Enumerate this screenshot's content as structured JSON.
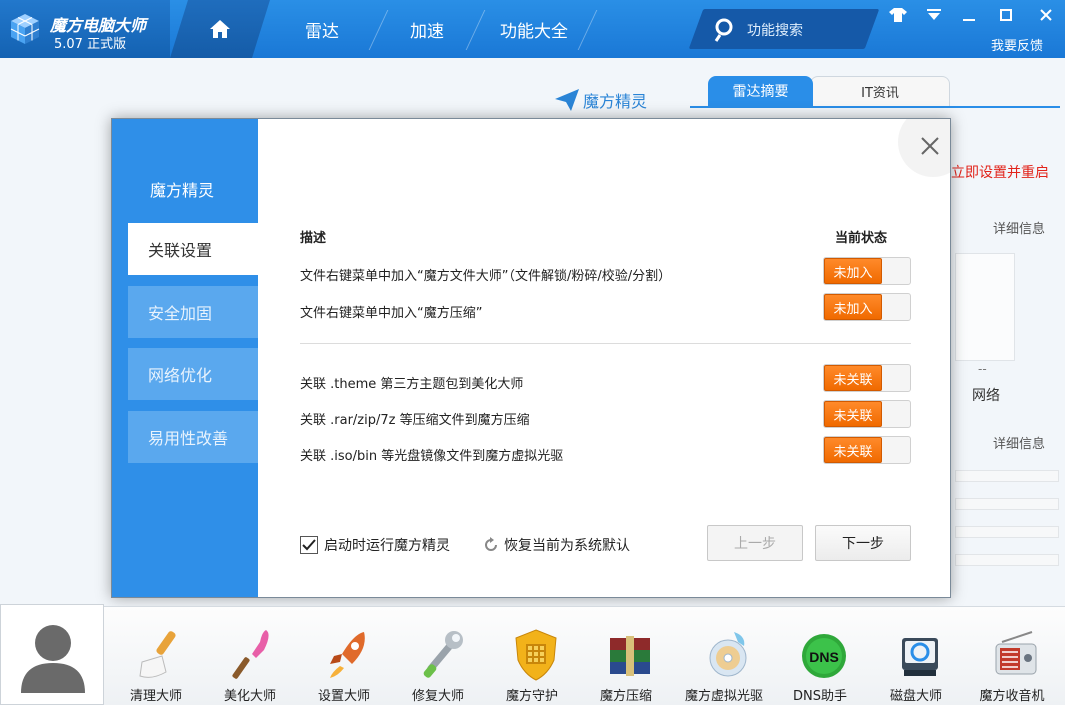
{
  "app": {
    "title": "魔方电脑大师",
    "version": "5.07 正式版"
  },
  "nav": {
    "items": [
      "雷达",
      "加速",
      "功能大全"
    ],
    "search_label": "功能搜索",
    "feedback": "我要反馈"
  },
  "background": {
    "wizard_link": "魔方精灵",
    "tabs": [
      "雷达摘要",
      "IT资讯"
    ],
    "red_text": "立即设置并重启",
    "detail_1": "详细信息",
    "detail_2": "详细信息",
    "dash": "--",
    "net_label": "网络"
  },
  "dialog": {
    "side_title": "魔方精灵",
    "side_items": [
      "关联设置",
      "安全加固",
      "网络优化",
      "易用性改善"
    ],
    "active_index": 0,
    "col_desc": "描述",
    "col_status": "当前状态",
    "rows": [
      {
        "text": "文件右键菜单中加入“魔方文件大师”（文件解锁/粉碎/校验/分割）",
        "status": "未加入"
      },
      {
        "text": "文件右键菜单中加入“魔方压缩”",
        "status": "未加入"
      },
      {
        "text": "关联 .theme 第三方主题包到美化大师",
        "status": "未关联"
      },
      {
        "text": "关联 .rar/zip/7z 等压缩文件到魔方压缩",
        "status": "未关联"
      },
      {
        "text": "关联 .iso/bin 等光盘镜像文件到魔方虚拟光驱",
        "status": "未关联"
      }
    ],
    "startup_label": "启动时运行魔方精灵",
    "startup_checked": true,
    "restore_label": "恢复当前为系统默认",
    "prev_label": "上一步",
    "next_label": "下一步"
  },
  "tools": [
    "清理大师",
    "美化大师",
    "设置大师",
    "修复大师",
    "魔方守护",
    "魔方压缩",
    "魔方虚拟光驱",
    "DNS助手",
    "磁盘大师",
    "魔方收音机"
  ],
  "colors": {
    "accent": "#2a8ee8",
    "toggle": "#f06a00",
    "warning": "#e2231a"
  }
}
